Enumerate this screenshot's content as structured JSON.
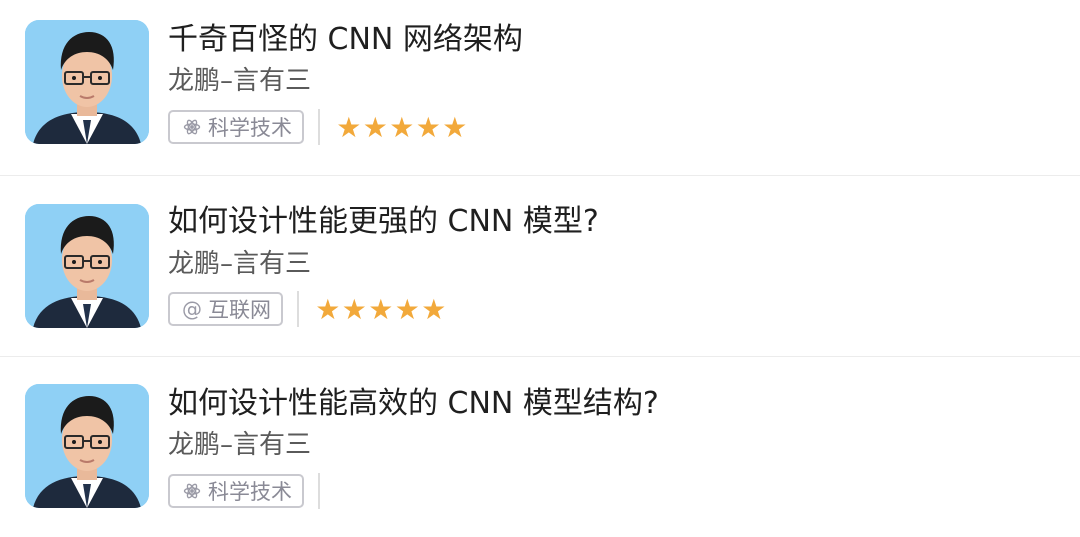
{
  "articles": [
    {
      "title": "千奇百怪的 CNN 网络架构",
      "author": "龙鹏–言有三",
      "tag": {
        "icon": "atom-icon",
        "label": "科学技术"
      },
      "rating": 5
    },
    {
      "title": "如何设计性能更强的 CNN 模型?",
      "author": "龙鹏–言有三",
      "tag": {
        "icon": "at-icon",
        "label": "互联网"
      },
      "rating": 5
    },
    {
      "title": "如何设计性能高效的 CNN 模型结构?",
      "author": "龙鹏–言有三",
      "tag": {
        "icon": "atom-icon",
        "label": "科学技术"
      },
      "rating": null
    }
  ],
  "colors": {
    "star": "#f2a93b",
    "avatar_bg": "#8fd0f5",
    "tag_border": "#c9c9cf"
  }
}
